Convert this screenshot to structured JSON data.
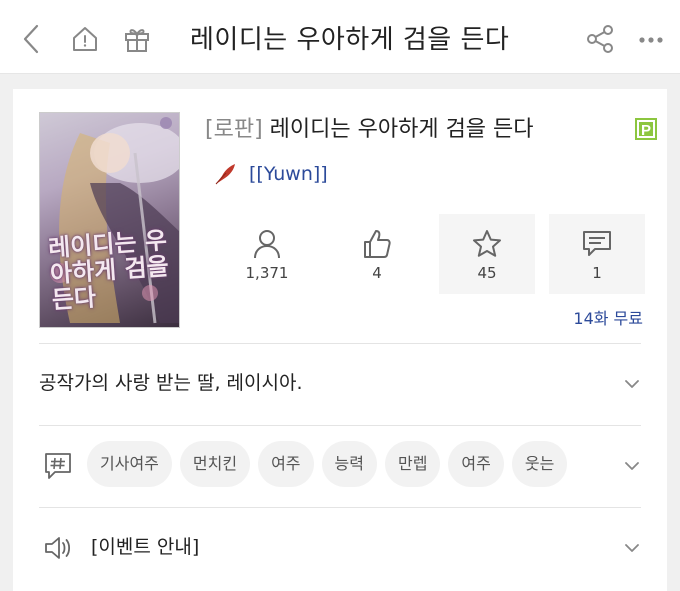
{
  "header": {
    "title": "레이디는 우아하게 검을 든다",
    "icons": [
      "back-icon",
      "home-icon",
      "gift-icon",
      "share-icon",
      "more-icon"
    ]
  },
  "book": {
    "genre_tag": "[로판]",
    "title": "레이디는 우아하게 검을 든다",
    "cover_title": "레이디는 우아하게 검을 든다",
    "badge": "P",
    "author": "[[Yuwn]]",
    "stats": {
      "views": "1,371",
      "likes": "4",
      "favorites": "45",
      "comments": "1"
    },
    "free_episodes": "14화 무료"
  },
  "synopsis": "공작가의 사랑 받는 딸, 레이시아.",
  "tags": [
    "기사여주",
    "먼치킨",
    "여주",
    "능력",
    "만렙",
    "여주",
    "웃는"
  ],
  "event": "[이벤트 안내]",
  "colors": {
    "badge_green": "#8cc63f",
    "link_blue": "#2c4a9a",
    "quill_red": "#c0392b"
  }
}
